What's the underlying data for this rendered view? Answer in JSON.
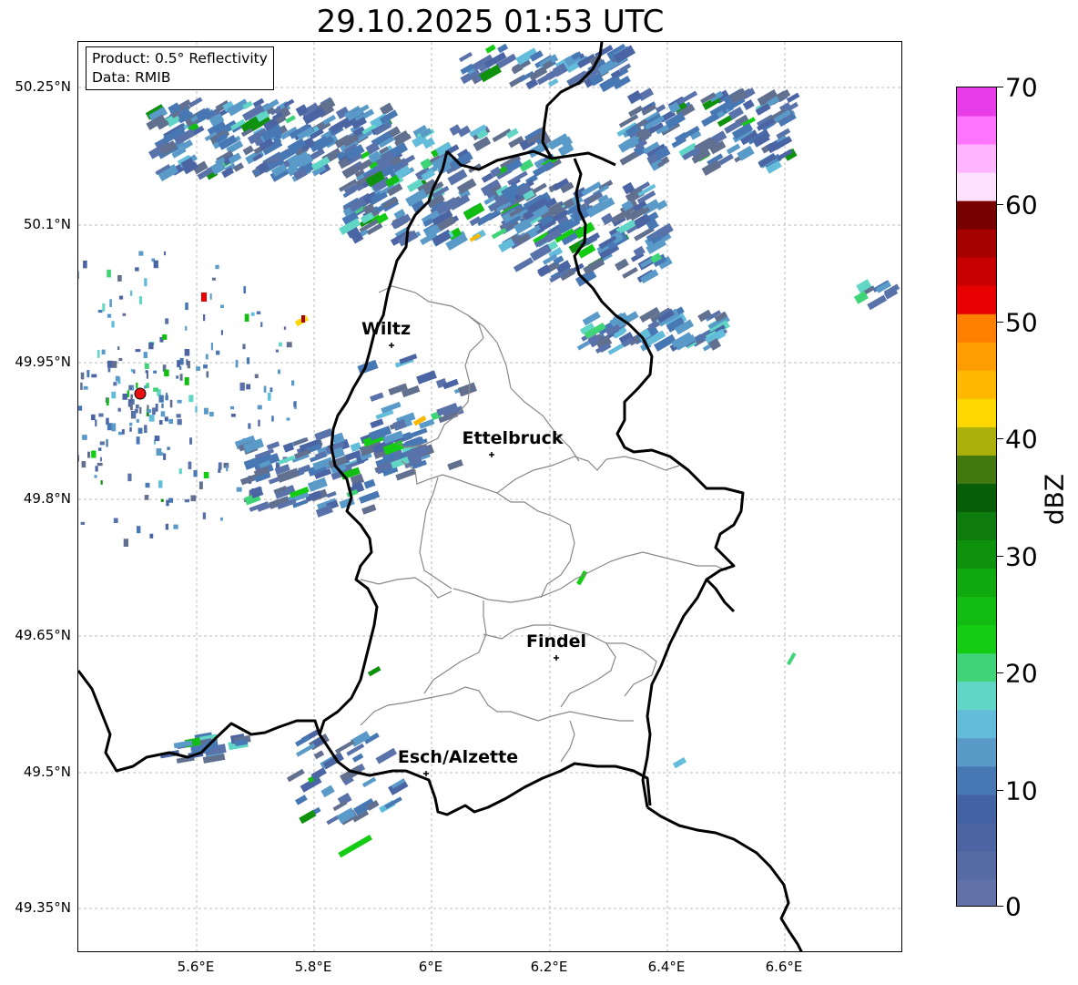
{
  "title": "29.10.2025 01:53 UTC",
  "info": {
    "product": "Product: 0.5° Reflectivity",
    "data": "Data: RMIB"
  },
  "axes": {
    "lat_labels": [
      "50.25°N",
      "50.1°N",
      "49.95°N",
      "49.8°N",
      "49.65°N",
      "49.5°N",
      "49.35°N"
    ],
    "lon_labels": [
      "5.6°E",
      "5.8°E",
      "6°E",
      "6.2°E",
      "6.4°E",
      "6.6°E"
    ],
    "grid": true
  },
  "cities": {
    "wiltz": "Wiltz",
    "ettelbruck": "Ettelbruck",
    "findel": "Findel",
    "esch": "Esch/Alzette"
  },
  "colorbar": {
    "label": "dBZ",
    "ticks": [
      "0",
      "10",
      "20",
      "30",
      "40",
      "50",
      "60",
      "70"
    ],
    "colors": [
      "#6272a8",
      "#566aa3",
      "#4c64a2",
      "#4262a4",
      "#4878b4",
      "#5a9ac8",
      "#62bcda",
      "#62d6c6",
      "#40d478",
      "#14cc14",
      "#12bc12",
      "#10aa10",
      "#0e920e",
      "#0e7c0e",
      "#085e08",
      "#427810",
      "#acb00a",
      "#ffd700",
      "#ffb800",
      "#ff9d00",
      "#ff7f00",
      "#e80000",
      "#c80000",
      "#a60000",
      "#780000",
      "#ffe0ff",
      "#ffb4ff",
      "#ff74ff",
      "#e83ce8"
    ]
  },
  "map": {
    "radar_site_color": "#e81010",
    "border_color": "#000000",
    "canton_color": "#888888"
  }
}
